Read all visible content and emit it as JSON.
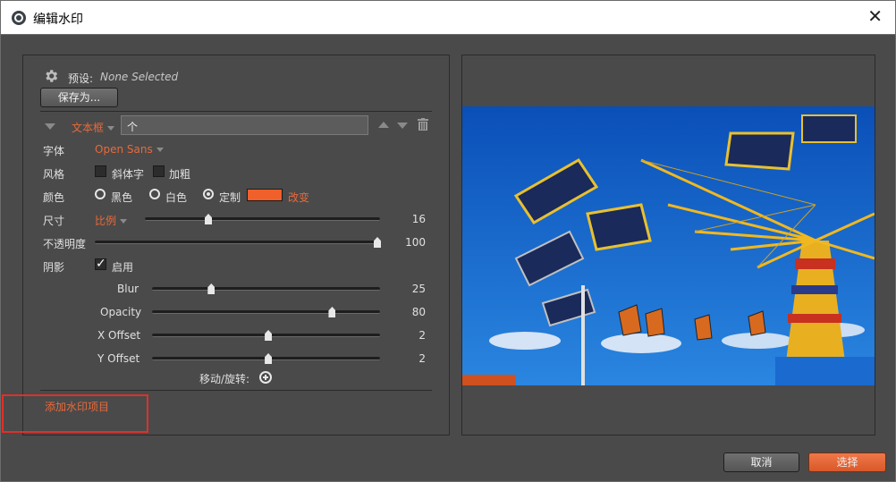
{
  "window": {
    "title": "编辑水印"
  },
  "colors": {
    "accent": "#e8693a",
    "swatch": "#f0602a",
    "highlight": "#e0302a"
  },
  "preset": {
    "label": "预设:",
    "value": "None Selected",
    "save_as": "保存为..."
  },
  "text_item": {
    "type_label": "文本框",
    "text_value": "个"
  },
  "font": {
    "label": "字体",
    "value": "Open Sans"
  },
  "style": {
    "label": "风格",
    "italic": "斜体字",
    "bold": "加粗",
    "italic_checked": false,
    "bold_checked": false
  },
  "color": {
    "label": "颜色",
    "black": "黑色",
    "white": "白色",
    "custom": "定制",
    "change": "改变",
    "selected": "custom"
  },
  "size": {
    "label": "尺寸",
    "mode": "比例",
    "value": "16",
    "fraction": 0.27
  },
  "opacity": {
    "label": "不透明度",
    "value": "100",
    "fraction": 1.0
  },
  "shadow": {
    "label": "阴影",
    "enable_label": "启用",
    "enabled": true,
    "blur": {
      "label": "Blur",
      "value": "25",
      "fraction": 0.26
    },
    "opacity": {
      "label": "Opacity",
      "value": "80",
      "fraction": 0.79
    },
    "x_offset": {
      "label": "X Offset",
      "value": "2",
      "fraction": 0.51
    },
    "y_offset": {
      "label": "Y Offset",
      "value": "2",
      "fraction": 0.51
    }
  },
  "move_rotate": {
    "label": "移动/旋转:"
  },
  "add_item": {
    "label": "添加水印项目"
  },
  "footer": {
    "cancel": "取消",
    "select": "选择"
  }
}
